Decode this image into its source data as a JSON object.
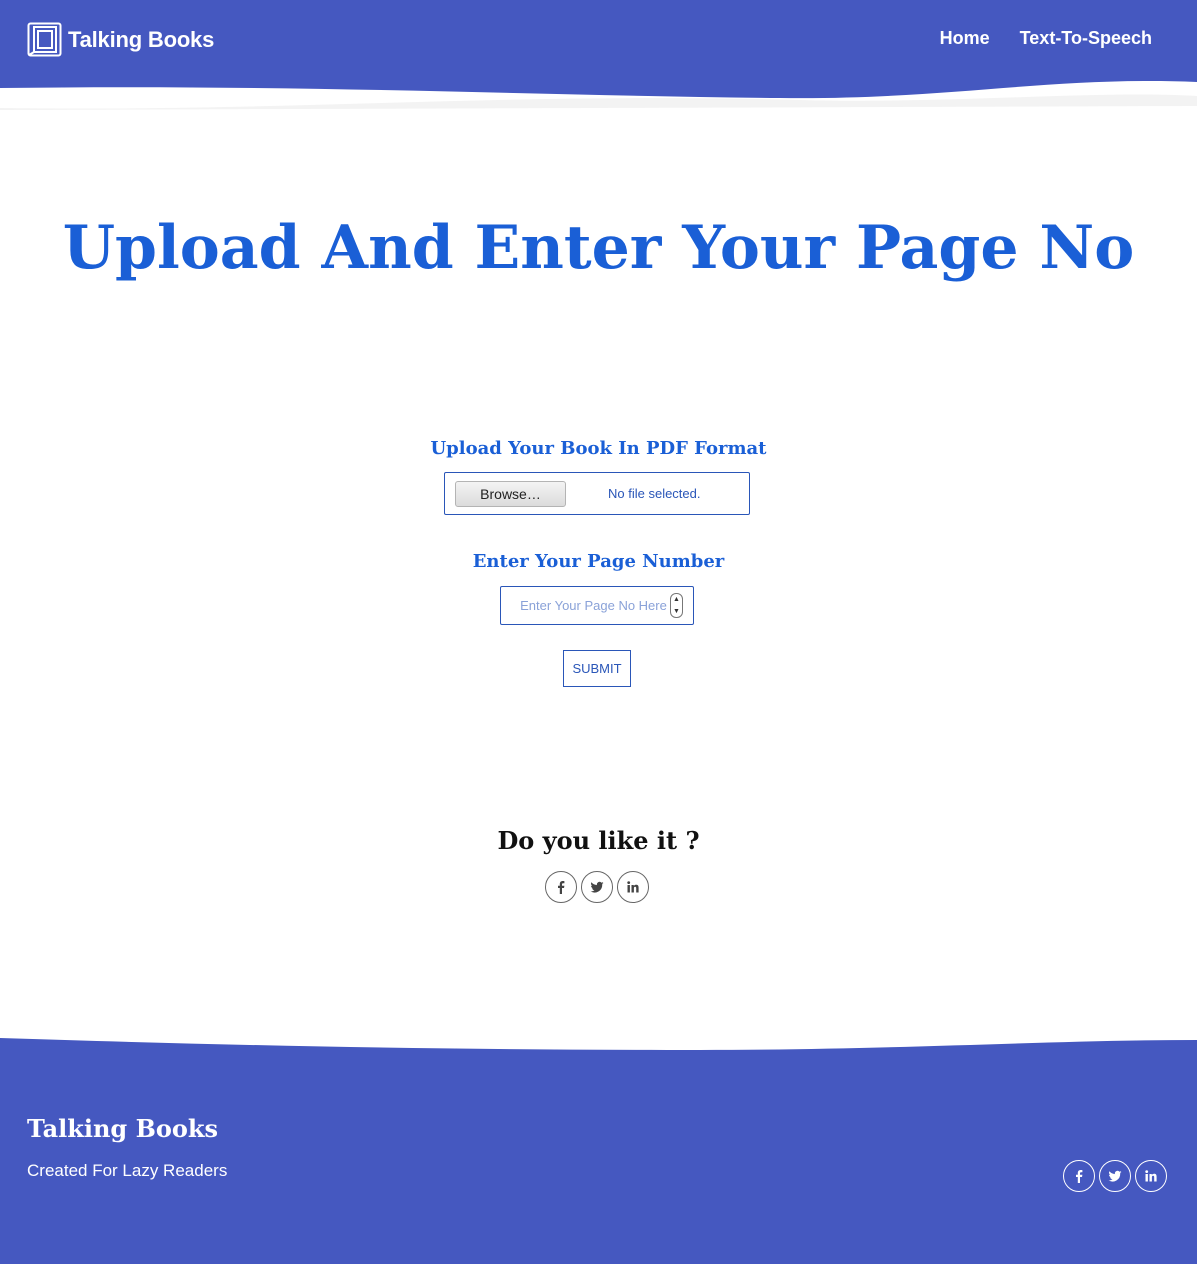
{
  "header": {
    "brand": "Talking Books",
    "nav": [
      "Home",
      "Text-To-Speech"
    ]
  },
  "main": {
    "title": "Upload And Enter Your Page No",
    "upload_label": "Upload Your Book In PDF Format",
    "browse_label": "Browse…",
    "file_status": "No file selected.",
    "page_label": "Enter Your Page Number",
    "page_placeholder": "Enter Your Page No Here",
    "submit_label": "SUBMIT"
  },
  "share": {
    "title": "Do you like it ?",
    "icons": [
      "facebook-icon",
      "twitter-icon",
      "linkedin-icon"
    ]
  },
  "footer": {
    "brand": "Talking Books",
    "tagline": "Created For Lazy Readers"
  },
  "colors": {
    "brand_blue": "#4558c0",
    "title_blue": "#1a5fd6",
    "border_blue": "#2a56b8"
  }
}
